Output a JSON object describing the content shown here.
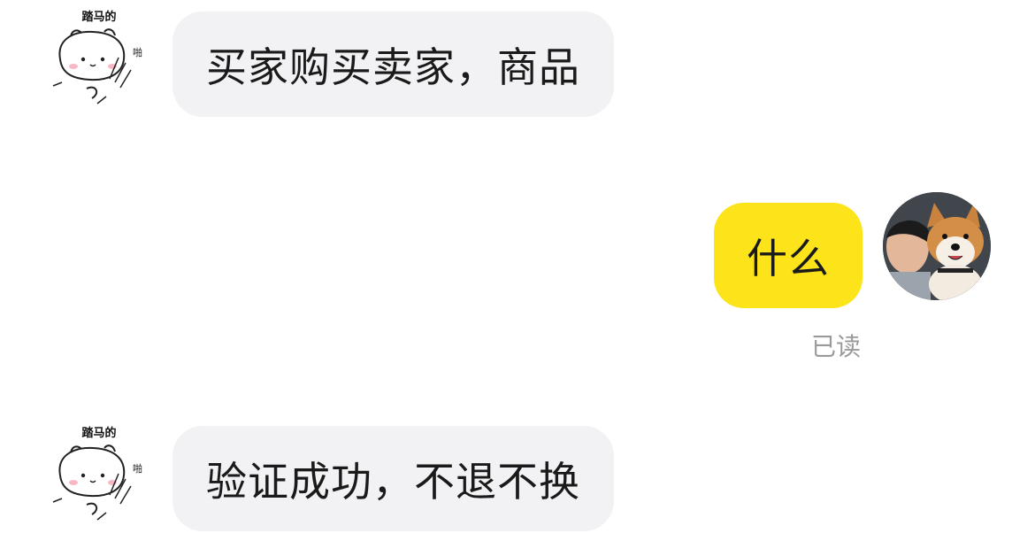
{
  "messages": [
    {
      "direction": "incoming",
      "sender_avatar": {
        "caption": "踏马的",
        "side_text": "啪"
      },
      "text": "买家购买卖家，商品"
    },
    {
      "direction": "outgoing",
      "text": "什么",
      "status": "已读"
    },
    {
      "direction": "incoming",
      "sender_avatar": {
        "caption": "踏马的",
        "side_text": "啪"
      },
      "text": "验证成功，不退不换"
    }
  ],
  "colors": {
    "incoming_bubble": "#f2f2f4",
    "outgoing_bubble": "#fde31a",
    "read_status": "#9a9a9a",
    "text": "#1a1a1a"
  }
}
